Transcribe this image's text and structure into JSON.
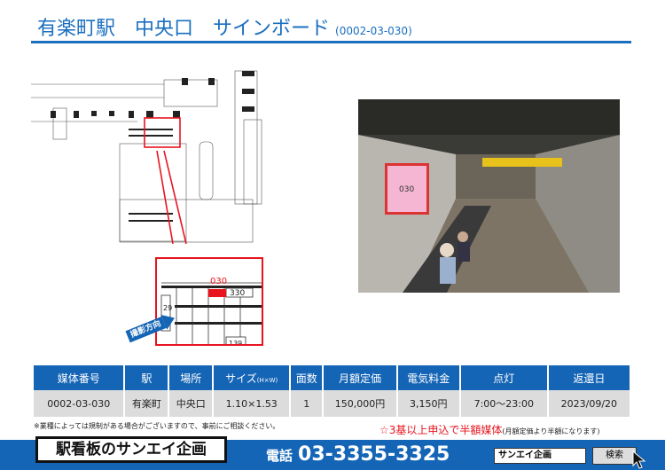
{
  "header": {
    "title": "有楽町駅　中央口　サインボード",
    "code": "(0002-03-030)"
  },
  "inset": {
    "board_id": "030",
    "labels": [
      "330",
      "29",
      "139"
    ],
    "direction_label": "撮影方向"
  },
  "photo": {
    "board_label": "030"
  },
  "table": {
    "headers": [
      "媒体番号",
      "駅",
      "場所",
      "サイズ",
      "面数",
      "月額定価",
      "電気料金",
      "点灯",
      "返還日"
    ],
    "size_unit": "(H×W)",
    "row": [
      "0002-03-030",
      "有楽町",
      "中央口",
      "1.10×1.53",
      "1",
      "150,000円",
      "3,150円",
      "7:00～23:00",
      "2023/09/20"
    ]
  },
  "note": "※業種によっては規制がある場合がございますので、事前にご相談ください。",
  "promo": {
    "main": "☆3基以上申込で半額媒体",
    "sub": "(月額定価より半額になります)"
  },
  "footer": {
    "logo": "駅看板のサンエイ企画",
    "phone_label": "電話",
    "phone": "03-3355-3325",
    "search_value": "サンエイ企画",
    "search_button": "検索"
  },
  "colors": {
    "accent": "#1565b6",
    "highlight": "#e8141e",
    "board": "#f4b6d2"
  }
}
